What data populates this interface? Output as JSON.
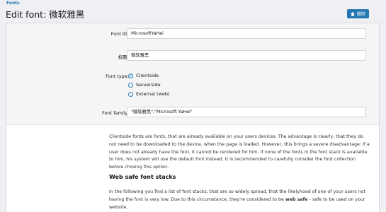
{
  "breadcrumb": "Fonts",
  "page_title": "Edit font: 微软雅黑",
  "delete_label": "删除",
  "form": {
    "font_id": {
      "label": "Font ID:",
      "value": "MicrosoftYaHei"
    },
    "title": {
      "label": "标题:",
      "value": "微软雅黑"
    },
    "font_type": {
      "label": "Font type:",
      "options": [
        {
          "label": "Clientside",
          "checked": true
        },
        {
          "label": "Serverside",
          "checked": false
        },
        {
          "label": "External (web)",
          "checked": false
        }
      ]
    },
    "font_family": {
      "label": "Font family:",
      "value": "\"微软雅黑\",\"Microsoft YaHei\""
    }
  },
  "description": {
    "paragraph1": "Clientside fonts are fonts, that are already available on your users devices. The advantage is clearly, that they do not need to be downloaded to the device, when the page is loaded. However, this brings a severe disadvantage: If a user does not already have the font, it cannot be rendered for him. If none of the fonts in the font stack is available to him, his system will use the default font instead. It is recommended to carefully consider the font collection before chosing this option.",
    "heading": "Web safe font stacks",
    "paragraph2_start": "In the following you find a list of font stacks, that are so widely spread, that the likelyhood of one of your users not having the font is very low. Due to this circumstance, they're considered to be ",
    "paragraph2_bold": "web safe",
    "paragraph2_end": " - safe to be used on your website."
  },
  "colors": {
    "accent": "#2577b1",
    "background": "#eef0f3",
    "panel": "#f5f5f5"
  },
  "icons": {
    "delete": "trash-icon",
    "radio_checked": "check-icon"
  }
}
